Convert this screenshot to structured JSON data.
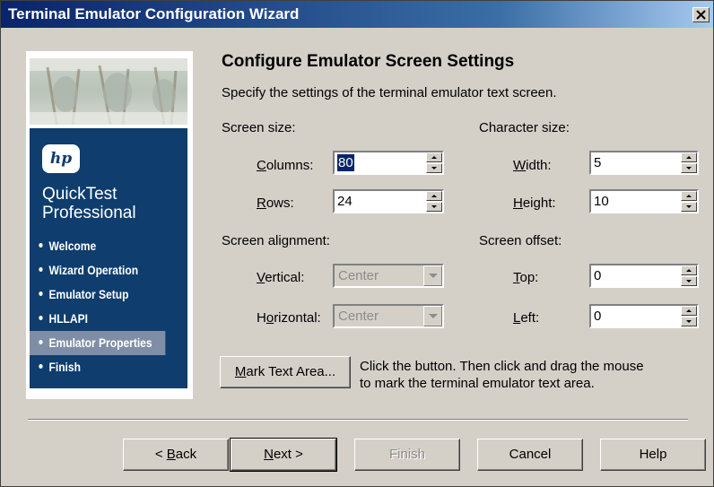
{
  "window": {
    "title": "Terminal Emulator Configuration Wizard"
  },
  "sidebar": {
    "logo": "hp",
    "product_line1": "QuickTest",
    "product_line2": "Professional",
    "items": [
      {
        "label": "Welcome",
        "selected": false
      },
      {
        "label": "Wizard Operation",
        "selected": false
      },
      {
        "label": "Emulator Setup",
        "selected": false
      },
      {
        "label": "HLLAPI",
        "selected": false
      },
      {
        "label": "Emulator Properties",
        "selected": true
      },
      {
        "label": "Finish",
        "selected": false
      }
    ]
  },
  "page": {
    "heading": "Configure Emulator Screen Settings",
    "description": "Specify the settings of the terminal emulator text screen."
  },
  "screen_size": {
    "label": "Screen size:",
    "columns": {
      "label_pre": "",
      "label_u": "C",
      "label_post": "olumns:",
      "value": "80"
    },
    "rows": {
      "label_u": "R",
      "label_post": "ows:",
      "value": "24"
    }
  },
  "character_size": {
    "label": "Character size:",
    "width": {
      "label_u": "W",
      "label_post": "idth:",
      "value": "5"
    },
    "height": {
      "label_u": "H",
      "label_post": "eight:",
      "value": "10"
    }
  },
  "screen_alignment": {
    "label": "Screen alignment:",
    "vertical": {
      "label_u": "V",
      "label_post": "ertical:",
      "value": "Center"
    },
    "horizontal": {
      "label_pre": "H",
      "label_u": "o",
      "label_post": "rizontal:",
      "value": "Center"
    }
  },
  "screen_offset": {
    "label": "Screen offset:",
    "top": {
      "label_u": "T",
      "label_post": "op:",
      "value": "0"
    },
    "left": {
      "label_u": "L",
      "label_post": "eft:",
      "value": "0"
    }
  },
  "mark_text": {
    "button_u": "M",
    "button_post": "ark Text Area...",
    "hint_line1": "Click the button. Then click and drag the mouse",
    "hint_line2": "to mark the terminal emulator text area."
  },
  "footer": {
    "back_pre": "< ",
    "back_u": "B",
    "back_post": "ack",
    "next_u": "N",
    "next_post": "ext >",
    "finish": "Finish",
    "cancel": "Cancel",
    "help": "Help"
  }
}
